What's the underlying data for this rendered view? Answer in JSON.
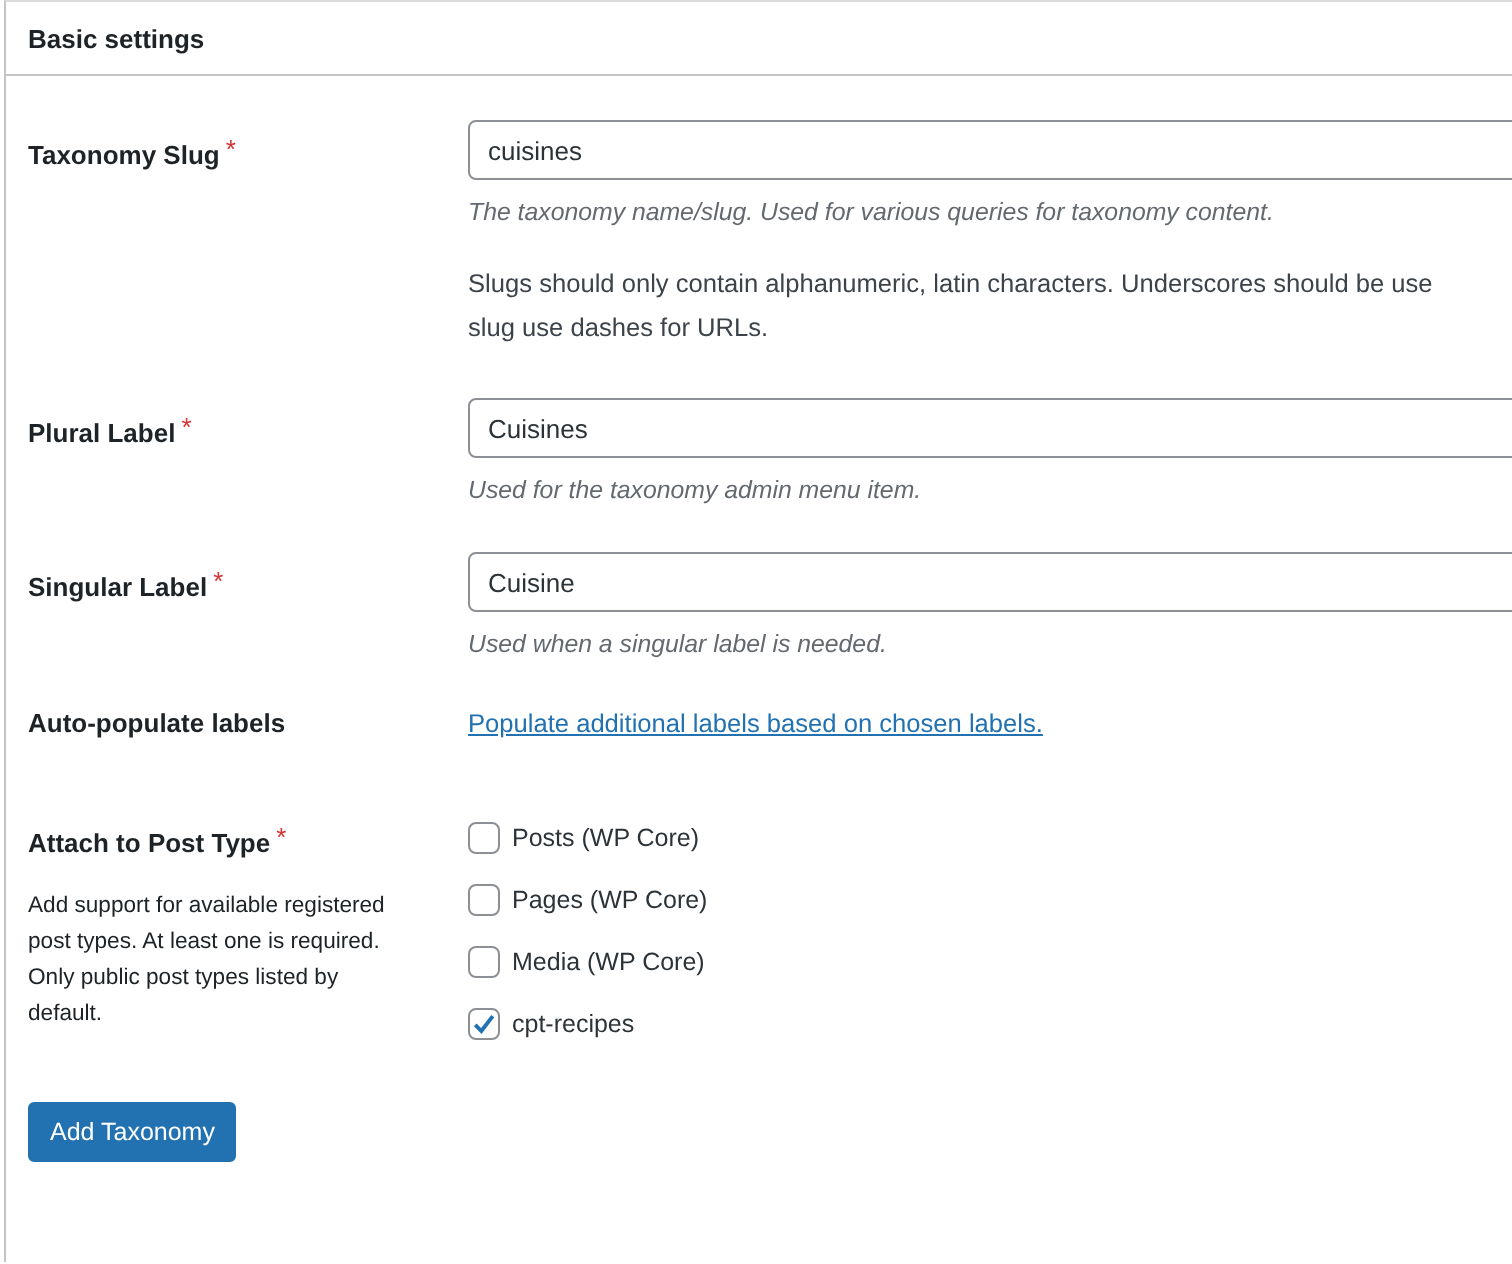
{
  "panel": {
    "title": "Basic settings"
  },
  "fields": [
    {
      "kind": "text",
      "label": "Taxonomy Slug",
      "required_mark": "*",
      "value": "cuisines",
      "help": "The taxonomy name/slug. Used for various queries for taxonomy content.",
      "notes": [
        "Slugs should only contain alphanumeric, latin characters. Underscores should be use",
        "slug use dashes for URLs."
      ]
    },
    {
      "kind": "text",
      "label": "Plural Label",
      "required_mark": "*",
      "value": "Cuisines",
      "help": "Used for the taxonomy admin menu item."
    },
    {
      "kind": "text",
      "label": "Singular Label",
      "required_mark": "*",
      "value": "Cuisine",
      "help": "Used when a singular label is needed."
    },
    {
      "kind": "link",
      "label": "Auto-populate labels",
      "link": "Populate additional labels based on chosen labels."
    },
    {
      "kind": "checkboxes",
      "label": "Attach to Post Type",
      "required_mark": "*",
      "description": "Add support for available registered post types. At least one is required. Only public post types listed by default.",
      "options": [
        {
          "label": "Posts (WP Core)",
          "checked": false
        },
        {
          "label": "Pages (WP Core)",
          "checked": false
        },
        {
          "label": "Media (WP Core)",
          "checked": false
        },
        {
          "label": "cpt-recipes",
          "checked": true
        }
      ]
    }
  ],
  "submit": "Add Taxonomy"
}
